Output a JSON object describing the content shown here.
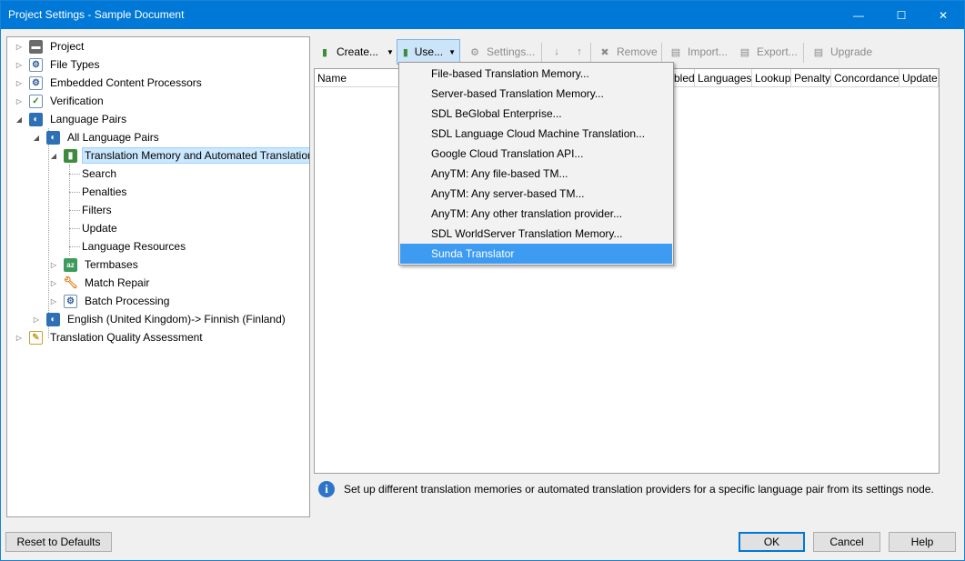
{
  "window": {
    "title": "Project Settings - Sample Document",
    "minimize_glyph": "—",
    "maximize_glyph": "☐",
    "close_glyph": "✕"
  },
  "tree": {
    "nodes": [
      {
        "label": "Project",
        "icon": "folder-icon"
      },
      {
        "label": "File Types",
        "icon": "file-types-icon"
      },
      {
        "label": "Embedded Content Processors",
        "icon": "gear-doc-icon"
      },
      {
        "label": "Verification",
        "icon": "checkmark-doc-icon"
      },
      {
        "label": "Language Pairs",
        "icon": "language-pairs-icon"
      },
      {
        "label": "All Language Pairs",
        "icon": "language-pairs-icon"
      },
      {
        "label": "Translation Memory and Automated Translation",
        "icon": "tm-icon"
      },
      {
        "label": "Search",
        "icon": ""
      },
      {
        "label": "Penalties",
        "icon": ""
      },
      {
        "label": "Filters",
        "icon": ""
      },
      {
        "label": "Update",
        "icon": ""
      },
      {
        "label": "Language Resources",
        "icon": ""
      },
      {
        "label": "Termbases",
        "icon": "termbase-icon"
      },
      {
        "label": "Match Repair",
        "icon": "wrench-icon"
      },
      {
        "label": "Batch Processing",
        "icon": "batch-icon"
      },
      {
        "label": "English (United Kingdom)-> Finnish (Finland)",
        "icon": "language-pairs-icon"
      },
      {
        "label": "Translation Quality Assessment",
        "icon": "clipboard-icon"
      }
    ]
  },
  "toolbar": {
    "create_label": "Create...",
    "use_label": "Use...",
    "settings_label": "Settings...",
    "remove_label": "Remove",
    "import_label": "Import...",
    "export_label": "Export...",
    "upgrade_label": "Upgrade"
  },
  "grid": {
    "columns": [
      "Name",
      "bled",
      "Languages",
      "Lookup",
      "Penalty",
      "Concordance",
      "Update"
    ]
  },
  "use_menu": {
    "items": [
      "File-based Translation Memory...",
      "Server-based Translation Memory...",
      "SDL BeGlobal Enterprise...",
      "SDL Language Cloud Machine Translation...",
      "Google Cloud Translation API...",
      "AnyTM: Any file-based TM...",
      "AnyTM: Any server-based TM...",
      "AnyTM: Any other translation provider...",
      "SDL WorldServer Translation Memory...",
      "Sunda Translator"
    ],
    "highlighted": "Sunda Translator"
  },
  "info": {
    "text": "Set up different translation memories or automated translation providers for a specific language pair from its settings node."
  },
  "buttons": {
    "reset": "Reset to Defaults",
    "ok": "OK",
    "cancel": "Cancel",
    "help": "Help"
  },
  "colors": {
    "titlebar": "#0078d7",
    "selection": "#cce8ff",
    "menu_highlight": "#3d9bf1"
  }
}
